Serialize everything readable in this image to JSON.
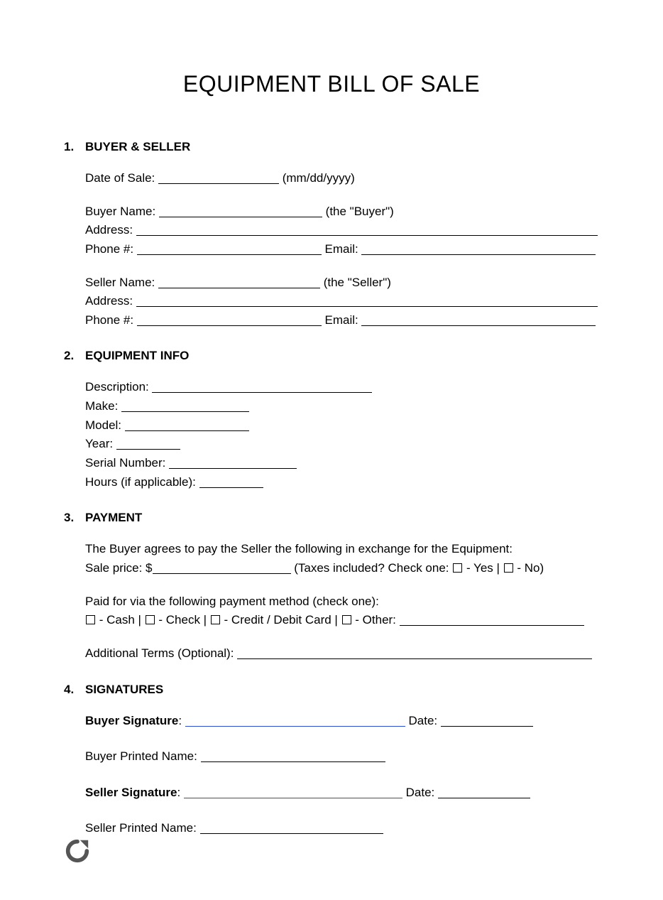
{
  "title": "EQUIPMENT BILL OF SALE",
  "sections": {
    "s1": {
      "num": "1.",
      "title": "BUYER & SELLER"
    },
    "s2": {
      "num": "2.",
      "title": "EQUIPMENT INFO"
    },
    "s3": {
      "num": "3.",
      "title": "PAYMENT"
    },
    "s4": {
      "num": "4.",
      "title": "SIGNATURES"
    }
  },
  "labels": {
    "date_of_sale": "Date of Sale: ",
    "date_hint": " (mm/dd/yyyy)",
    "buyer_name": "Buyer Name: ",
    "the_buyer": " (the \"Buyer\")",
    "seller_name": "Seller Name: ",
    "the_seller": " (the \"Seller\")",
    "address": "Address: ",
    "phone": "Phone #: ",
    "email": " Email: ",
    "description": "Description: ",
    "make": "Make: ",
    "model": "Model: ",
    "year": "Year: ",
    "serial": "Serial Number: ",
    "hours": "Hours (if applicable): ",
    "payment_intro": "The Buyer agrees to pay the Seller the following in exchange for the Equipment:",
    "sale_price": "Sale price: $",
    "taxes_q": " (Taxes included? Check one: ",
    "yes": " - Yes | ",
    "no": " - No)",
    "paid_via": "Paid for via the following payment method (check one):",
    "cash": " - Cash | ",
    "check": " - Check | ",
    "card": " - Credit / Debit Card | ",
    "other": " - Other: ",
    "addl_terms": "Additional Terms (Optional): ",
    "buyer_sig": "Buyer Signature",
    "seller_sig": "Seller Signature",
    "buyer_printed": "Buyer Printed Name: ",
    "seller_printed": "Seller Printed Name: ",
    "date": " Date: ",
    "colon_sp": ": "
  }
}
